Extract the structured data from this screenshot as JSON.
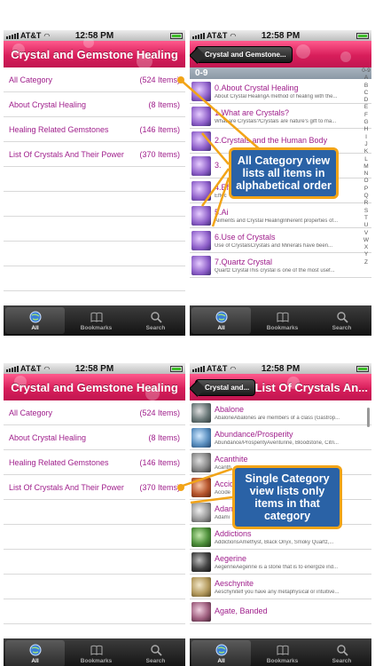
{
  "status": {
    "carrier": "AT&T",
    "time": "12:58 PM"
  },
  "screens": {
    "top_left": {
      "title": "Crystal and Gemstone Healing",
      "categories": [
        {
          "label": "All Category",
          "count": "(524 Items)"
        },
        {
          "label": "About Crystal Healing",
          "count": "(8 Items)"
        },
        {
          "label": "Healing Related Gemstones",
          "count": "(146 Items)"
        },
        {
          "label": "List Of Crystals And Their Power",
          "count": "(370 Items)"
        }
      ]
    },
    "top_right": {
      "back": "Crystal and Gemstone...",
      "section": "0-9",
      "items": [
        {
          "title": "0.About Crystal Healing",
          "sub": "About Crystal HealingA method of healing with the..."
        },
        {
          "title": "1.What are Crystals?",
          "sub": "What are Crystals?Crystals are nature's gift to ma..."
        },
        {
          "title": "2.Crystals and the Human Body",
          "sub": ""
        },
        {
          "title": "3.",
          "sub": ""
        },
        {
          "title": "4.Eff",
          "sub": "Effec"
        },
        {
          "title": "5.Ai",
          "sub": "Aliments and Crystal HealingInherent properties of..."
        },
        {
          "title": "6.Use of Crystals",
          "sub": "Use of CrystalsCrystals and Minerals have been..."
        },
        {
          "title": "7.Quartz Crystal",
          "sub": "Quartz CrystalThis crystal is one of the most usef..."
        }
      ],
      "index": [
        "0-9",
        "A",
        "B",
        "C",
        "D",
        "E",
        "F",
        "G",
        "H",
        "I",
        "J",
        "K",
        "L",
        "M",
        "N",
        "O",
        "P",
        "Q",
        "R",
        "S",
        "T",
        "U",
        "V",
        "W",
        "X",
        "Y",
        "Z"
      ]
    },
    "bottom_left": {
      "title": "Crystal and Gemstone Healing",
      "categories": [
        {
          "label": "All Category",
          "count": "(524 Items)"
        },
        {
          "label": "About Crystal Healing",
          "count": "(8 Items)"
        },
        {
          "label": "Healing Related Gemstones",
          "count": "(146 Items)"
        },
        {
          "label": "List Of Crystals And Their Power",
          "count": "(370 Items)"
        }
      ]
    },
    "bottom_right": {
      "back": "Crystal and...",
      "title": "List Of Crystals An...",
      "items": [
        {
          "title": "Abalone",
          "sub": "AbaloneAbalones are members of a class (Gastrop..."
        },
        {
          "title": "Abundance/Prosperity",
          "sub": "Abundance/ProsperityAventurine, Bloodstone, Citri..."
        },
        {
          "title": "Acanthite",
          "sub": "Acanth"
        },
        {
          "title": "Accid",
          "sub": "Accide"
        },
        {
          "title": "Adam",
          "sub": "Adami"
        },
        {
          "title": "Addictions",
          "sub": "AddictionsAmethyst, Black Onyx, Smoky Quartz,..."
        },
        {
          "title": "Aegerine",
          "sub": "AegerineAegerine is a stone that is to energize ind..."
        },
        {
          "title": "Aeschynite",
          "sub": "Aeschynitelf you have any metaphysical or intuitive..."
        },
        {
          "title": "Agate, Banded",
          "sub": ""
        }
      ]
    }
  },
  "tabs": [
    {
      "label": "All",
      "icon": "globe-icon"
    },
    {
      "label": "Bookmarks",
      "icon": "book-icon"
    },
    {
      "label": "Search",
      "icon": "search-icon"
    }
  ],
  "callouts": {
    "top": "All Category view lists all items in alphabetical order",
    "bottom": "Single Category view lists only items in that category"
  },
  "colors": {
    "navbar": "#d81e5b",
    "accent_text": "#a0208c",
    "callout_fill": "#2a62a6",
    "callout_border": "#f2a417"
  }
}
